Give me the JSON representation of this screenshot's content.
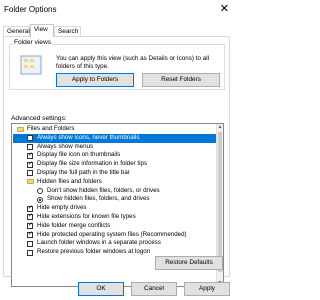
{
  "window": {
    "title": "Folder Options",
    "close_glyph": "✕"
  },
  "tabs": [
    {
      "label": "General",
      "active": false
    },
    {
      "label": "View",
      "active": true
    },
    {
      "label": "Search",
      "active": false
    }
  ],
  "folder_views": {
    "group_label": "Folder views",
    "description": "You can apply this view (such as Details or Icons) to all folders of this type.",
    "apply_button": "Apply to Folders",
    "reset_button": "Reset Folders"
  },
  "advanced": {
    "label": "Advanced settings:",
    "items": [
      {
        "type": "folder",
        "label": "Files and Folders",
        "indent": 0,
        "checked": false,
        "selected": false
      },
      {
        "type": "checkbox",
        "label": "Always show icons, never thumbnails",
        "indent": 1,
        "checked": false,
        "selected": true
      },
      {
        "type": "checkbox",
        "label": "Always show menus",
        "indent": 1,
        "checked": false,
        "selected": false
      },
      {
        "type": "checkbox",
        "label": "Display file icon on thumbnails",
        "indent": 1,
        "checked": true,
        "selected": false
      },
      {
        "type": "checkbox",
        "label": "Display file size information in folder tips",
        "indent": 1,
        "checked": true,
        "selected": false
      },
      {
        "type": "checkbox",
        "label": "Display the full path in the title bar",
        "indent": 1,
        "checked": false,
        "selected": false
      },
      {
        "type": "folder",
        "label": "Hidden files and folders",
        "indent": 1,
        "checked": false,
        "selected": false
      },
      {
        "type": "radio",
        "label": "Don't show hidden files, folders, or drives",
        "indent": 2,
        "checked": false,
        "selected": false
      },
      {
        "type": "radio",
        "label": "Show hidden files, folders, and drives",
        "indent": 2,
        "checked": true,
        "selected": false
      },
      {
        "type": "checkbox",
        "label": "Hide empty drives",
        "indent": 1,
        "checked": true,
        "selected": false
      },
      {
        "type": "checkbox",
        "label": "Hide extensions for known file types",
        "indent": 1,
        "checked": true,
        "selected": false
      },
      {
        "type": "checkbox",
        "label": "Hide folder merge conflicts",
        "indent": 1,
        "checked": true,
        "selected": false
      },
      {
        "type": "checkbox",
        "label": "Hide protected operating system files (Recommended)",
        "indent": 1,
        "checked": true,
        "selected": false
      },
      {
        "type": "checkbox",
        "label": "Launch folder windows in a separate process",
        "indent": 1,
        "checked": false,
        "selected": false
      },
      {
        "type": "checkbox",
        "label": "Restore previous folder windows at logon",
        "indent": 1,
        "checked": false,
        "selected": false
      }
    ],
    "restore_button": "Restore Defaults"
  },
  "footer": {
    "ok": "OK",
    "cancel": "Cancel",
    "apply": "Apply"
  },
  "colors": {
    "accent": "#0078d7",
    "folder": "#f8d775"
  }
}
